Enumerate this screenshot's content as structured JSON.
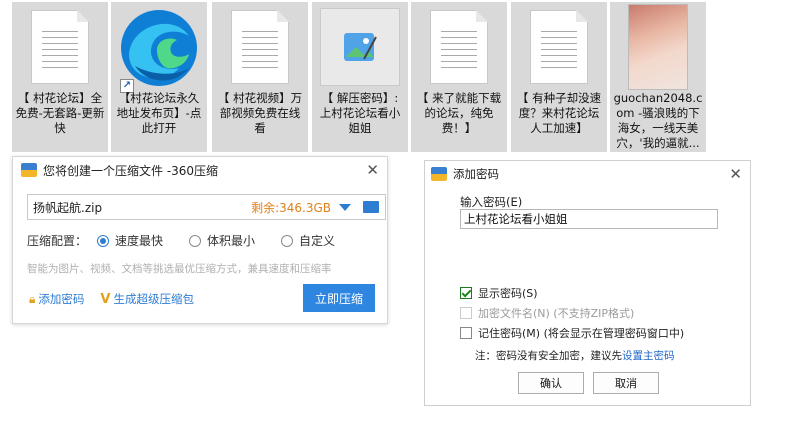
{
  "desktop": {
    "files": [
      {
        "label": "【 村花论坛】全免费-无套路-更新快",
        "thumb": "document"
      },
      {
        "label": "【村花论坛永久地址发布页】-点此打开",
        "thumb": "edge-shortcut"
      },
      {
        "label": "【 村花视频】万部视频免费在线看",
        "thumb": "document"
      },
      {
        "label": "【 解压密码】: 上村花论坛看小姐姐",
        "thumb": "image"
      },
      {
        "label": "【 来了就能下载的论坛，纯免费！】",
        "thumb": "document"
      },
      {
        "label": "【 有种子却没速度？来村花论坛人工加速】",
        "thumb": "document"
      },
      {
        "label": "guochan2048.com -骚浪贱的下海女，一线天美穴，'我的逼就...",
        "thumb": "photo"
      }
    ]
  },
  "compress_dialog": {
    "title": "您将创建一个压缩文件 -360压缩",
    "filename": "扬帆起航.zip",
    "free_space": "剩余:346.3GB",
    "config_label": "压缩配置：",
    "options": [
      {
        "label": "速度最快",
        "selected": true
      },
      {
        "label": "体积最小",
        "selected": false
      },
      {
        "label": "自定义",
        "selected": false
      }
    ],
    "hint": "智能为图片、视频、文档等挑选最优压缩方式，兼具速度和压缩率",
    "add_password_link": "添加密码",
    "super_package_link": "生成超级压缩包",
    "compress_button": "立即压缩"
  },
  "password_dialog": {
    "title": "添加密码",
    "input_label": "输入密码(E)",
    "password_value": "上村花论坛看小姐姐",
    "show_password_label": "显示密码(S)",
    "show_password_checked": true,
    "encrypt_names_label": "加密文件名(N) (不支持ZIP格式)",
    "remember_label": "记住密码(M) (将会显示在管理密码窗口中)",
    "note_text": "注：密码没有安全加密，建议先",
    "note_link": "设置主密码",
    "ok_button": "确认",
    "cancel_button": "取消"
  },
  "colors": {
    "accent_blue": "#2e86e0",
    "free_space_orange": "#e0811c",
    "tile_bg": "#d9d9d9"
  }
}
